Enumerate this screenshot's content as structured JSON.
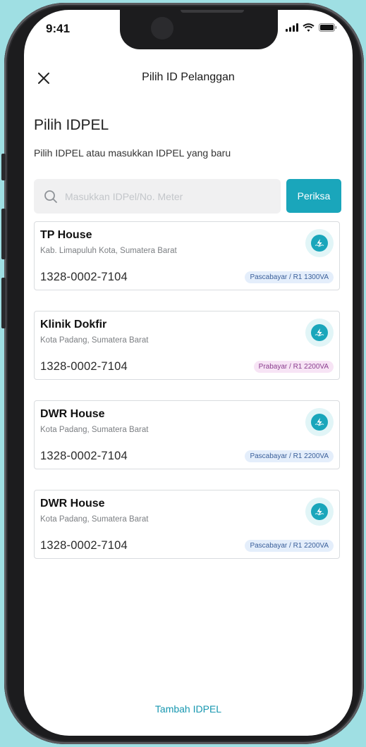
{
  "status_bar": {
    "time": "9:41",
    "icons": [
      "signal-icon",
      "wifi-icon",
      "battery-icon"
    ]
  },
  "header": {
    "close_icon": "close-icon",
    "title": "Pilih ID Pelanggan"
  },
  "intro": {
    "heading": "Pilih IDPEL",
    "subtitle": "Pilih IDPEL atau masukkan IDPEL yang baru"
  },
  "search": {
    "icon": "search-icon",
    "placeholder": "Masukkan IDPel/No. Meter",
    "value": "",
    "button_label": "Periksa"
  },
  "customers": [
    {
      "name": "TP House",
      "location": "Kab. Limapuluh Kota, Sumatera Barat",
      "id": "1328-0002-7104",
      "badge": "Pascabayar / R1 1300VA",
      "badge_type": "postpaid",
      "logo": "pln-logo-icon"
    },
    {
      "name": "Klinik Dokfir",
      "location": "Kota Padang, Sumatera Barat",
      "id": "1328-0002-7104",
      "badge": "Prabayar / R1 2200VA",
      "badge_type": "prepaid",
      "logo": "pln-logo-icon"
    },
    {
      "name": "DWR House",
      "location": "Kota Padang, Sumatera Barat",
      "id": "1328-0002-7104",
      "badge": "Pascabayar / R1 2200VA",
      "badge_type": "postpaid",
      "logo": "pln-logo-icon"
    },
    {
      "name": "DWR House",
      "location": "Kota Padang, Sumatera Barat",
      "id": "1328-0002-7104",
      "badge": "Pascabayar / R1 2200VA",
      "badge_type": "postpaid",
      "logo": "pln-logo-icon"
    }
  ],
  "footer": {
    "add_label": "Tambah IDPEL"
  },
  "colors": {
    "accent": "#1aa6bb",
    "background": "#9fdfe3",
    "postpaid_badge_bg": "#e4eefb",
    "prepaid_badge_bg": "#f7e4f5"
  }
}
